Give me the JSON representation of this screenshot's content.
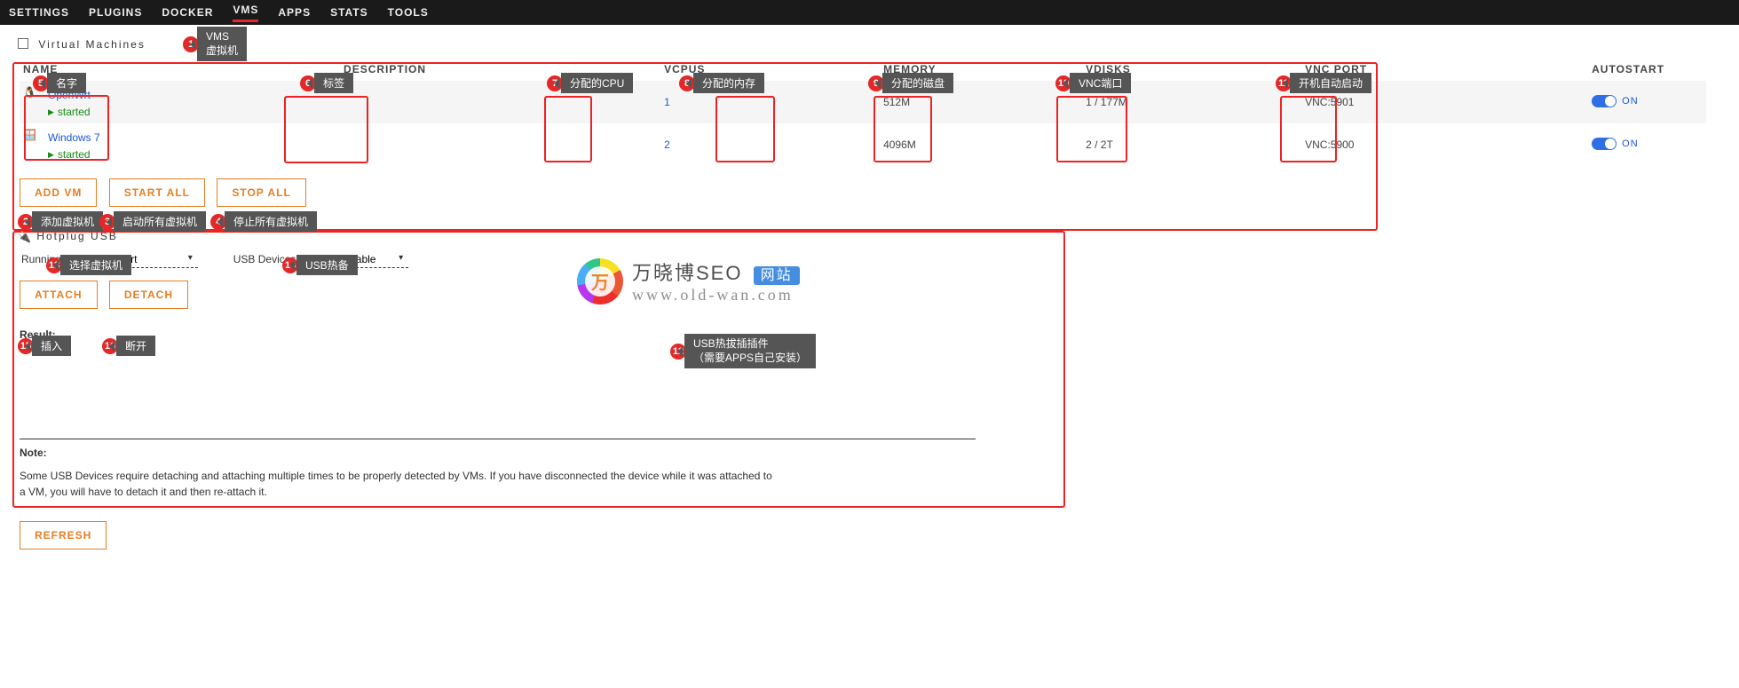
{
  "nav": {
    "items": [
      "SETTINGS",
      "PLUGINS",
      "DOCKER",
      "VMS",
      "APPS",
      "STATS",
      "TOOLS"
    ],
    "active": "VMS"
  },
  "sections": {
    "vm_title": "Virtual Machines",
    "usb_title": "Hotplug USB"
  },
  "table": {
    "headers": {
      "name": "NAME",
      "desc": "DESCRIPTION",
      "cpus": "VCPUS",
      "mem": "MEMORY",
      "vdisks": "VDISKS",
      "vnc": "VNC PORT",
      "auto": "AUTOSTART"
    },
    "rows": [
      {
        "name": "OpenWrt",
        "status": "started",
        "desc": "",
        "cpus": "1",
        "mem": "512M",
        "vdisks": "1 / 177M",
        "vnc": "VNC:5901",
        "auto": "ON",
        "os": "linux"
      },
      {
        "name": "Windows 7",
        "status": "started",
        "desc": "",
        "cpus": "2",
        "mem": "4096M",
        "vdisks": "2 / 2T",
        "vnc": "VNC:5900",
        "auto": "ON",
        "os": "windows"
      }
    ]
  },
  "buttons": {
    "add": "ADD VM",
    "start_all": "START ALL",
    "stop_all": "STOP ALL",
    "attach": "ATTACH",
    "detach": "DETACH",
    "refresh": "REFRESH"
  },
  "hotplug": {
    "running_label": "Running VMs:",
    "running_value": "OpenWrt",
    "usb_label": "USB Devices:",
    "usb_value": "None available",
    "result_label": "Result:",
    "note_title": "Note:",
    "note_body": "Some USB Devices require detaching and attaching multiple times to be properly detected by VMs.  If you have disconnected the device while it was attached to a VM, you will have to detach it and then re-attach it."
  },
  "annotations": {
    "1": "VMS\n虚拟机",
    "2": "添加虚拟机",
    "3": "启动所有虚拟机",
    "4": "停止所有虚拟机",
    "5": "名字",
    "6": "标签",
    "7": "分配的CPU",
    "8": "分配的内存",
    "9": "分配的磁盘",
    "10": "VNC端口",
    "11": "开机自动启动",
    "12": "USB热拔插插件\n（需要APPS自己安装）",
    "13": "选择虚拟机",
    "14": "USB热备",
    "15": "插入",
    "16": "断开"
  },
  "watermark": {
    "brand": "万晓博SEO",
    "badge": "网站",
    "url": "www.old-wan.com",
    "glyph": "万"
  }
}
